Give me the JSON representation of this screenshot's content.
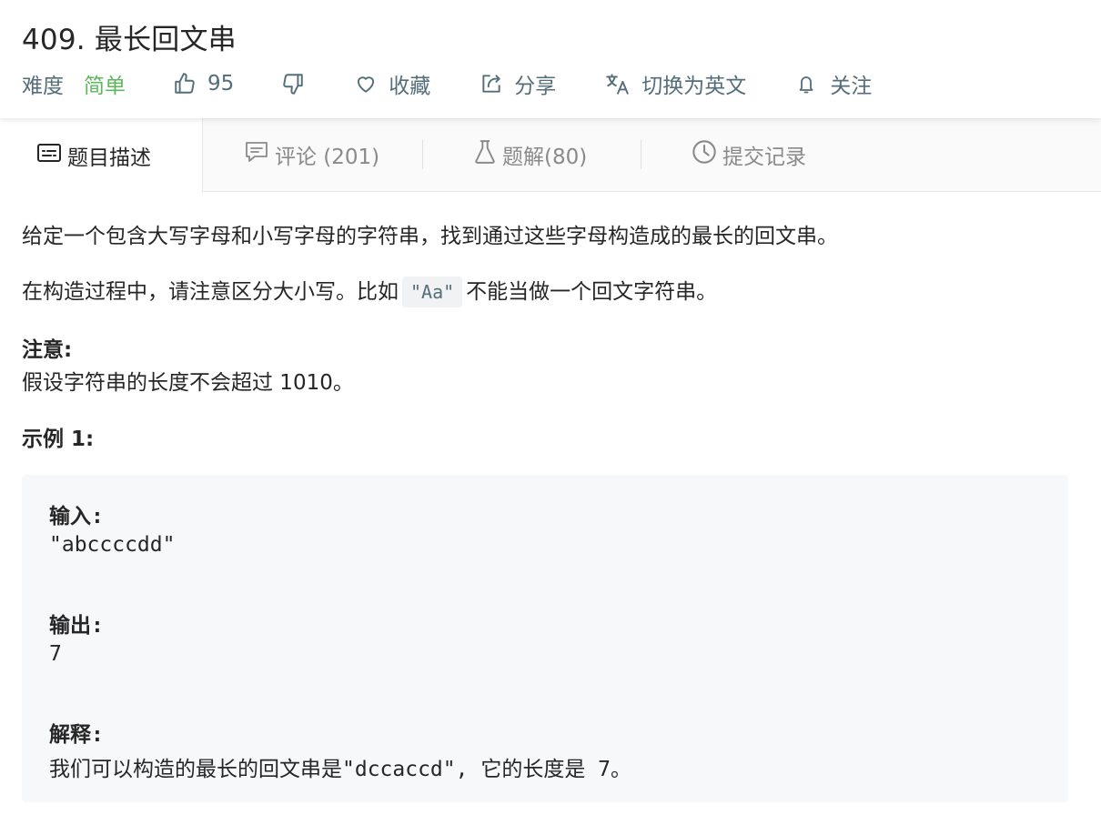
{
  "problem": {
    "title": "409. 最长回文串",
    "difficulty_label": "难度",
    "difficulty_value": "简单",
    "likes": "95",
    "favorite_label": "收藏",
    "share_label": "分享",
    "switch_lang_label": "切换为英文",
    "follow_label": "关注"
  },
  "tabs": [
    {
      "label": "题目描述"
    },
    {
      "label": "评论 (201)"
    },
    {
      "label": "题解(80)"
    },
    {
      "label": "提交记录"
    }
  ],
  "description": {
    "para1": "给定一个包含大写字母和小写字母的字符串，找到通过这些字母构造成的最长的回文串。",
    "para2_before": "在构造过程中，请注意区分大小写。比如",
    "para2_code": "\"Aa\"",
    "para2_after": "不能当做一个回文字符串。",
    "note_heading": "注意:",
    "note_text": "假设字符串的长度不会超过 1010。",
    "example_heading": "示例 1:"
  },
  "example": {
    "input_label": "输入:",
    "input_value": "\"abccccdd\"",
    "output_label": "输出:",
    "output_value": "7",
    "explain_label": "解释:",
    "explain_value": "我们可以构造的最长的回文串是\"dccaccd\", 它的长度是 7。"
  },
  "icons": {
    "like": "thumbs-up-icon",
    "dislike": "thumbs-down-icon",
    "favorite": "heart-icon",
    "share": "share-icon",
    "translate": "translate-icon",
    "follow": "bell-icon",
    "description": "description-icon",
    "comment": "comment-icon",
    "solution": "flask-icon",
    "submission": "clock-icon"
  },
  "colors": {
    "easy": "#5cb85c",
    "meta_text": "#546e7a",
    "tab_inactive": "#8a8a8a"
  }
}
